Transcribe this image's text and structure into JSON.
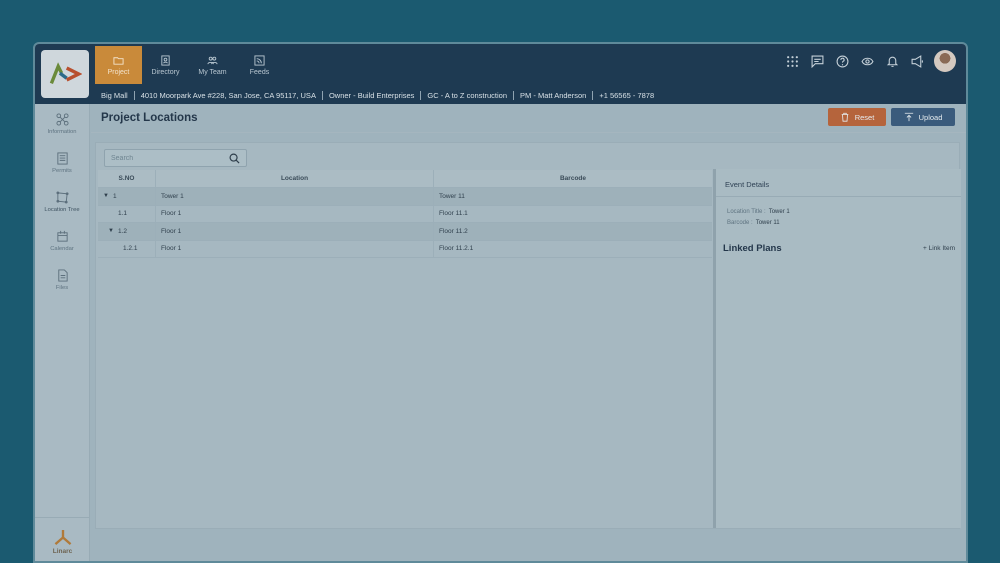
{
  "nav": {
    "tabs": [
      {
        "label": "Project",
        "icon": "folder-icon",
        "active": true
      },
      {
        "label": "Directory",
        "icon": "address-book-icon",
        "active": false
      },
      {
        "label": "My Team",
        "icon": "team-icon",
        "active": false
      },
      {
        "label": "Feeds",
        "icon": "rss-icon",
        "active": false
      }
    ]
  },
  "project_info": {
    "name": "Big Mall",
    "address": "4010 Moorpark Ave #228, San Jose, CA 95117, USA",
    "owner": "Owner - Build Enterprises",
    "gc": "GC - A to Z construction",
    "pm": "PM - Matt Anderson",
    "phone": "+1 56565 - 7878"
  },
  "sidebar": {
    "items": [
      {
        "label": "Information",
        "icon": "drone-icon"
      },
      {
        "label": "Permits",
        "icon": "document-list-icon"
      },
      {
        "label": "Location Tree",
        "icon": "shape-icon"
      },
      {
        "label": "Calendar",
        "icon": "calendar-icon"
      },
      {
        "label": "Files",
        "icon": "file-icon"
      }
    ],
    "brand": "Linarc"
  },
  "page": {
    "title": "Project Locations",
    "reset_label": "Reset",
    "upload_label": "Upload"
  },
  "search": {
    "placeholder": "Search"
  },
  "table": {
    "headers": [
      "S.NO",
      "Location",
      "Barcode"
    ],
    "rows": [
      {
        "sno": "1",
        "location": "Tower 1",
        "barcode": "Tower 11",
        "expanded": true
      },
      {
        "sno": "1.1",
        "location": "Floor 1",
        "barcode": "Floor 11.1"
      },
      {
        "sno": "1.2",
        "location": "Floor 1",
        "barcode": "Floor 11.2",
        "expanded": true
      },
      {
        "sno": "1.2.1",
        "location": "Floor 1",
        "barcode": "Floor 11.2.1"
      }
    ]
  },
  "details": {
    "title": "Event Details",
    "location_title_label": "Location Title :",
    "location_title_value": "Tower 1",
    "barcode_label": "Barcode :",
    "barcode_value": "Tower 11",
    "linked_plans": "Linked Plans",
    "link_item": "+ Link Item"
  },
  "colors": {
    "topbar": "#1e3a52",
    "active_tab": "#c98a3a",
    "reset": "#b5643c",
    "upload": "#3a5b7c"
  }
}
